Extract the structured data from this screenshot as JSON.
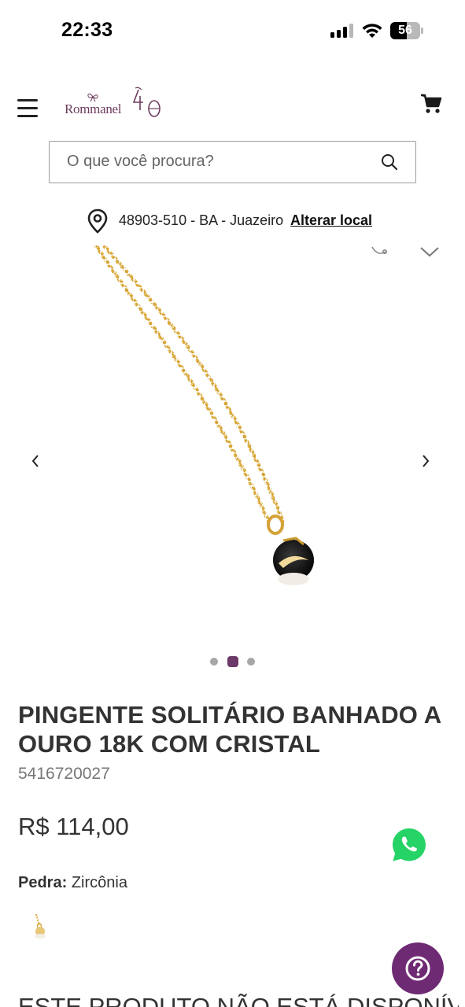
{
  "status_bar": {
    "time": "22:33",
    "battery_level": "56"
  },
  "header": {
    "logo_text": "Rommanel",
    "logo_anniversary": "40",
    "menu_icon": "hamburger-menu-icon",
    "cart_icon": "cart-icon"
  },
  "search": {
    "placeholder": "O que você procura?",
    "icon": "search-icon"
  },
  "location": {
    "text": "48903-510 - BA - Juazeiro",
    "link_label": "Alterar local",
    "icon": "map-pin-icon"
  },
  "gallery": {
    "image_count": 3,
    "active_index": 1
  },
  "product": {
    "title": "PINGENTE SOLITÁRIO BANHADO A OURO 18K COM CRISTAL",
    "sku": "5416720027",
    "price": "R$ 114,00",
    "attribute_label": "Pedra:",
    "attribute_value": "Zircônia",
    "unavailable_notice": "ESTE PRODUTO NÃO ESTÁ DISPONÍVEL"
  },
  "colors": {
    "brand": "#6e2a73",
    "accent_dot": "#6b3a68",
    "whatsapp": "#25d366"
  }
}
